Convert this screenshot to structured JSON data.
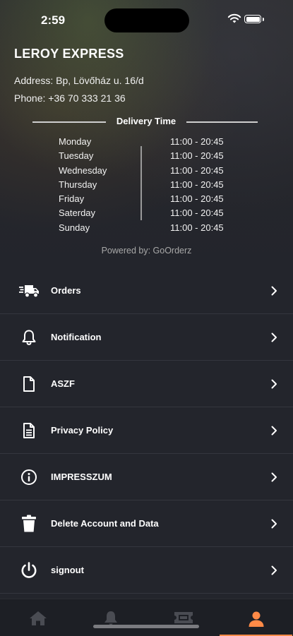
{
  "status": {
    "time": "2:59"
  },
  "restaurant": {
    "name": "LEROY EXPRESS",
    "address": "Address:  Bp, Lövőház u. 16/d",
    "phone": "Phone:  +36 70 333 21 36"
  },
  "delivery": {
    "title": "Delivery Time",
    "days": [
      "Monday",
      "Tuesday",
      "Wednesday",
      "Thursday",
      "Friday",
      "Saterday",
      "Sunday"
    ],
    "hours": [
      "11:00 - 20:45",
      "11:00 - 20:45",
      "11:00 - 20:45",
      "11:00 - 20:45",
      "11:00 - 20:45",
      "11:00 - 20:45",
      "11:00 - 20:45"
    ]
  },
  "powered_by": "Powered by: GoOrderz",
  "menu": {
    "items": [
      {
        "label": "Orders",
        "icon": "truck-icon"
      },
      {
        "label": "Notification",
        "icon": "bell-icon"
      },
      {
        "label": "ASZF",
        "icon": "file-icon"
      },
      {
        "label": "Privacy Policy",
        "icon": "document-icon"
      },
      {
        "label": "IMPRESSZUM",
        "icon": "info-icon"
      },
      {
        "label": "Delete Account and Data",
        "icon": "trash-icon"
      },
      {
        "label": "signout",
        "icon": "power-icon"
      }
    ]
  },
  "tabs": [
    {
      "name": "home",
      "icon": "home-icon"
    },
    {
      "name": "notifications",
      "icon": "bell-icon"
    },
    {
      "name": "coupons",
      "icon": "ticket-icon"
    },
    {
      "name": "profile",
      "icon": "user-icon",
      "active": true
    }
  ],
  "colors": {
    "accent": "#ff8a47",
    "background": "#23252c",
    "tab_inactive": "#4a4c53"
  }
}
